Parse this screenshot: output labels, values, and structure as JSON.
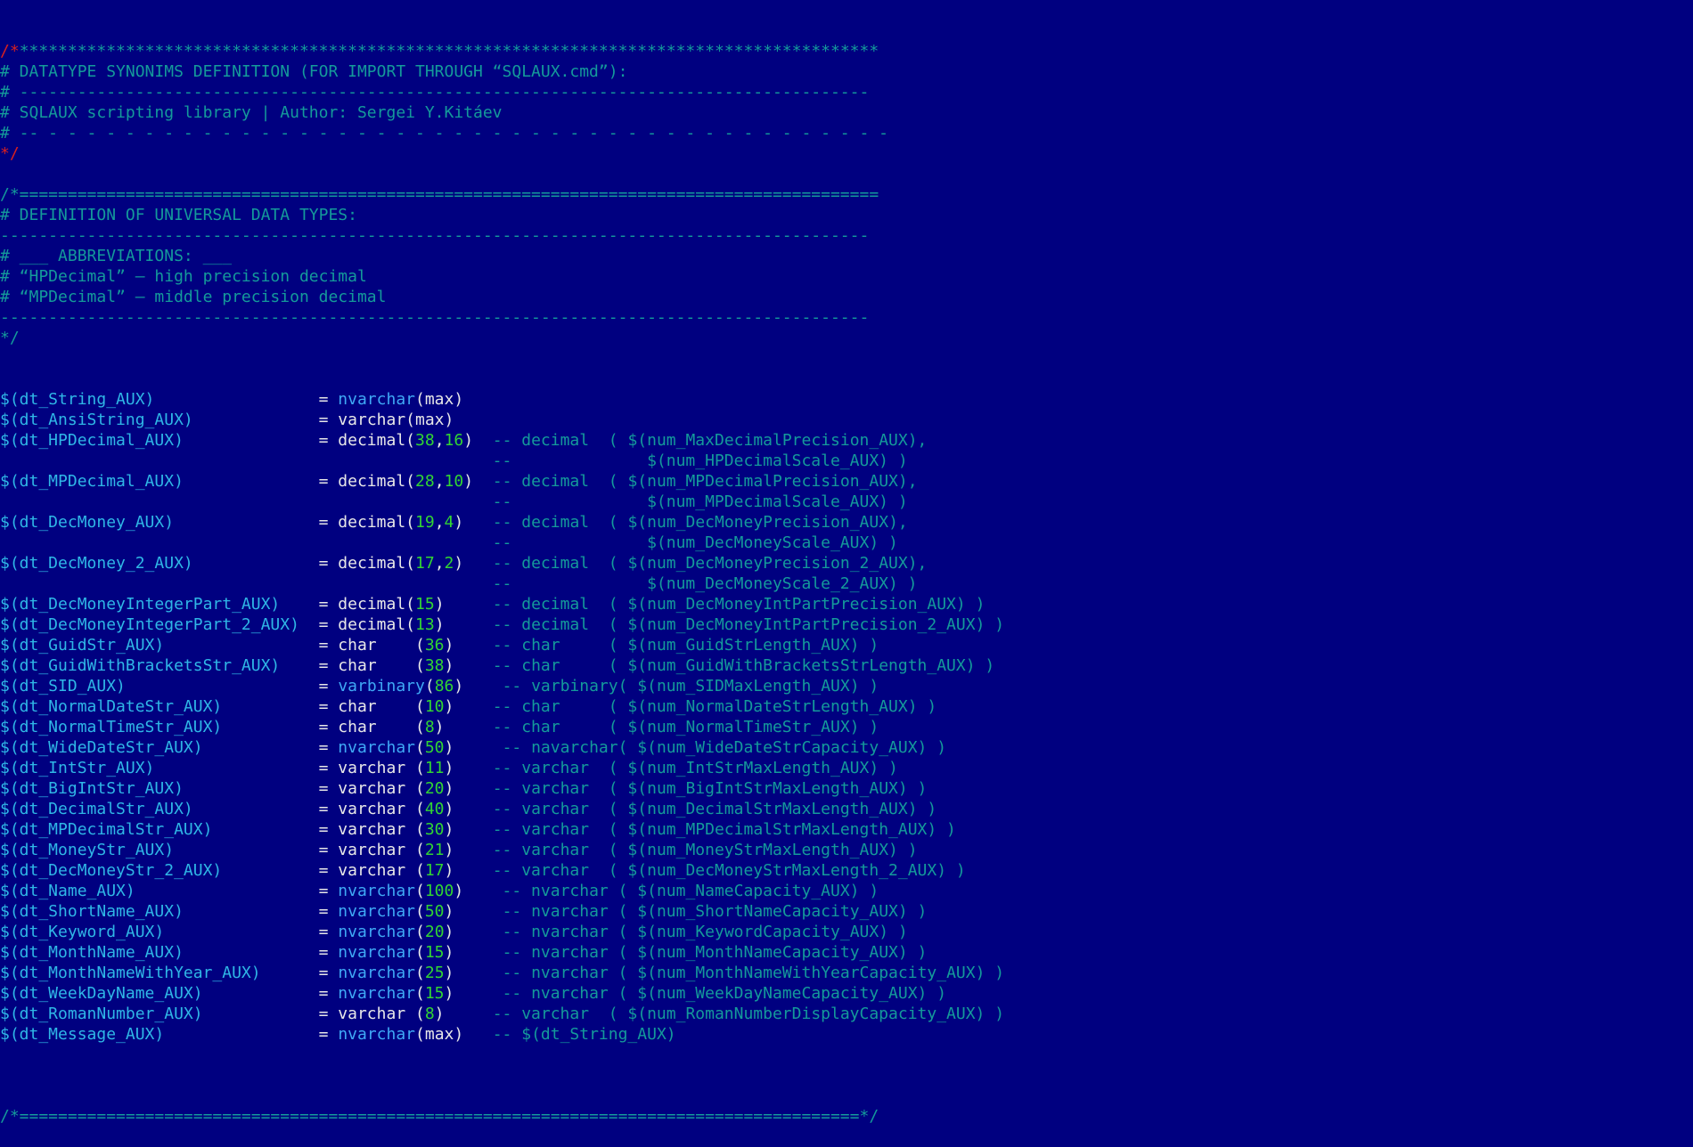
{
  "editor": {
    "background": "#000080",
    "colors": {
      "comment": "#149a9a",
      "comment_delimiter": "#d82020",
      "variable": "#2fb7e6",
      "type_keyword": "#3fa9f5",
      "plain_text": "#e8e8e8",
      "number": "#32d532"
    },
    "header": [
      {
        "segments": [
          {
            "cls": "red",
            "text": "/*"
          },
          {
            "cls": "cm",
            "text": "*****************************************************************************************"
          }
        ]
      },
      {
        "segments": [
          {
            "cls": "cm",
            "text": "# DATATYPE SYNONIMS DEFINITION (FOR IMPORT THROUGH “SQLAUX.cmd”):"
          }
        ]
      },
      {
        "segments": [
          {
            "cls": "cm",
            "text": "# ----------------------------------------------------------------------------------------"
          }
        ]
      },
      {
        "segments": [
          {
            "cls": "cm",
            "text": "# SQLAUX scripting library | Author: Sergei Y.Kitáev"
          }
        ]
      },
      {
        "segments": [
          {
            "cls": "cm",
            "text": "# -- - - - - - - - - - - - - - - - - - - - - - - - - - - - - - - - - - - - - - - - - - - - -"
          }
        ]
      },
      {
        "segments": [
          {
            "cls": "red",
            "text": "*/"
          }
        ]
      },
      {
        "segments": [
          {
            "cls": "cm",
            "text": ""
          }
        ]
      },
      {
        "segments": [
          {
            "cls": "cm",
            "text": "/*========================================================================================="
          }
        ]
      },
      {
        "segments": [
          {
            "cls": "cm",
            "text": "# DEFINITION OF UNIVERSAL DATA TYPES:"
          }
        ]
      },
      {
        "segments": [
          {
            "cls": "cm",
            "text": "------------------------------------------------------------------------------------------"
          }
        ]
      },
      {
        "segments": [
          {
            "cls": "cm",
            "text": "# ___ ABBREVIATIONS: ___"
          }
        ]
      },
      {
        "segments": [
          {
            "cls": "cm",
            "text": "# “HPDecimal” — high precision decimal"
          }
        ]
      },
      {
        "segments": [
          {
            "cls": "cm",
            "text": "# “MPDecimal” — middle precision decimal"
          }
        ]
      },
      {
        "segments": [
          {
            "cls": "cm",
            "text": "------------------------------------------------------------------------------------------"
          }
        ]
      },
      {
        "segments": [
          {
            "cls": "cm",
            "text": "*/"
          }
        ]
      }
    ],
    "definitions": [
      {
        "segments": [
          {
            "cls": "var",
            "text": "$(dt_String_AUX)"
          },
          {
            "cls": "txt",
            "text": "                 = "
          },
          {
            "cls": "kw",
            "text": "nvarchar"
          },
          {
            "cls": "txt",
            "text": "(max)"
          }
        ]
      },
      {
        "segments": [
          {
            "cls": "var",
            "text": "$(dt_AnsiString_AUX)"
          },
          {
            "cls": "txt",
            "text": "             = varchar(max)"
          }
        ]
      },
      {
        "segments": [
          {
            "cls": "var",
            "text": "$(dt_HPDecimal_AUX)"
          },
          {
            "cls": "txt",
            "text": "              = decimal("
          },
          {
            "cls": "num",
            "text": "38"
          },
          {
            "cls": "txt",
            "text": ","
          },
          {
            "cls": "num",
            "text": "16"
          },
          {
            "cls": "txt",
            "text": ")  "
          },
          {
            "cls": "cm",
            "text": "-- decimal  ( $(num_MaxDecimalPrecision_AUX),"
          }
        ]
      },
      {
        "segments": [
          {
            "cls": "cm",
            "text": "                                                   --              $(num_HPDecimalScale_AUX) )"
          }
        ]
      },
      {
        "segments": [
          {
            "cls": "var",
            "text": "$(dt_MPDecimal_AUX)"
          },
          {
            "cls": "txt",
            "text": "              = decimal("
          },
          {
            "cls": "num",
            "text": "28"
          },
          {
            "cls": "txt",
            "text": ","
          },
          {
            "cls": "num",
            "text": "10"
          },
          {
            "cls": "txt",
            "text": ")  "
          },
          {
            "cls": "cm",
            "text": "-- decimal  ( $(num_MPDecimalPrecision_AUX),"
          }
        ]
      },
      {
        "segments": [
          {
            "cls": "cm",
            "text": "                                                   --              $(num_MPDecimalScale_AUX) )"
          }
        ]
      },
      {
        "segments": [
          {
            "cls": "var",
            "text": "$(dt_DecMoney_AUX)"
          },
          {
            "cls": "txt",
            "text": "               = decimal("
          },
          {
            "cls": "num",
            "text": "19"
          },
          {
            "cls": "txt",
            "text": ","
          },
          {
            "cls": "num",
            "text": "4"
          },
          {
            "cls": "txt",
            "text": ")   "
          },
          {
            "cls": "cm",
            "text": "-- decimal  ( $(num_DecMoneyPrecision_AUX),"
          }
        ]
      },
      {
        "segments": [
          {
            "cls": "cm",
            "text": "                                                   --              $(num_DecMoneyScale_AUX) )"
          }
        ]
      },
      {
        "segments": [
          {
            "cls": "var",
            "text": "$(dt_DecMoney_2_AUX)"
          },
          {
            "cls": "txt",
            "text": "             = decimal("
          },
          {
            "cls": "num",
            "text": "17"
          },
          {
            "cls": "txt",
            "text": ","
          },
          {
            "cls": "num",
            "text": "2"
          },
          {
            "cls": "txt",
            "text": ")   "
          },
          {
            "cls": "cm",
            "text": "-- decimal  ( $(num_DecMoneyPrecision_2_AUX),"
          }
        ]
      },
      {
        "segments": [
          {
            "cls": "cm",
            "text": "                                                   --              $(num_DecMoneyScale_2_AUX) )"
          }
        ]
      },
      {
        "segments": [
          {
            "cls": "var",
            "text": "$(dt_DecMoneyIntegerPart_AUX)"
          },
          {
            "cls": "txt",
            "text": "    = decimal("
          },
          {
            "cls": "num",
            "text": "15"
          },
          {
            "cls": "txt",
            "text": ")     "
          },
          {
            "cls": "cm",
            "text": "-- decimal  ( $(num_DecMoneyIntPartPrecision_AUX) )"
          }
        ]
      },
      {
        "segments": [
          {
            "cls": "var",
            "text": "$(dt_DecMoneyIntegerPart_2_AUX)"
          },
          {
            "cls": "txt",
            "text": "  = decimal("
          },
          {
            "cls": "num",
            "text": "13"
          },
          {
            "cls": "txt",
            "text": ")     "
          },
          {
            "cls": "cm",
            "text": "-- decimal  ( $(num_DecMoneyIntPartPrecision_2_AUX) )"
          }
        ]
      },
      {
        "segments": [
          {
            "cls": "var",
            "text": "$(dt_GuidStr_AUX)"
          },
          {
            "cls": "txt",
            "text": "                = char    ("
          },
          {
            "cls": "num",
            "text": "36"
          },
          {
            "cls": "txt",
            "text": ")    "
          },
          {
            "cls": "cm",
            "text": "-- char     ( $(num_GuidStrLength_AUX) )"
          }
        ]
      },
      {
        "segments": [
          {
            "cls": "var",
            "text": "$(dt_GuidWithBracketsStr_AUX)"
          },
          {
            "cls": "txt",
            "text": "    = char    ("
          },
          {
            "cls": "num",
            "text": "38"
          },
          {
            "cls": "txt",
            "text": ")    "
          },
          {
            "cls": "cm",
            "text": "-- char     ( $(num_GuidWithBracketsStrLength_AUX) )"
          }
        ]
      },
      {
        "segments": [
          {
            "cls": "var",
            "text": "$(dt_SID_AUX)"
          },
          {
            "cls": "txt",
            "text": "                    = "
          },
          {
            "cls": "kw",
            "text": "varbinary"
          },
          {
            "cls": "txt",
            "text": "("
          },
          {
            "cls": "num",
            "text": "86"
          },
          {
            "cls": "txt",
            "text": ")    "
          },
          {
            "cls": "cm",
            "text": "-- varbinary( $(num_SIDMaxLength_AUX) )"
          }
        ]
      },
      {
        "segments": [
          {
            "cls": "var",
            "text": "$(dt_NormalDateStr_AUX)"
          },
          {
            "cls": "txt",
            "text": "          = char    ("
          },
          {
            "cls": "num",
            "text": "10"
          },
          {
            "cls": "txt",
            "text": ")    "
          },
          {
            "cls": "cm",
            "text": "-- char     ( $(num_NormalDateStrLength_AUX) )"
          }
        ]
      },
      {
        "segments": [
          {
            "cls": "var",
            "text": "$(dt_NormalTimeStr_AUX)"
          },
          {
            "cls": "txt",
            "text": "          = char    ("
          },
          {
            "cls": "num",
            "text": "8"
          },
          {
            "cls": "txt",
            "text": ")     "
          },
          {
            "cls": "cm",
            "text": "-- char     ( $(num_NormalTimeStr_AUX) )"
          }
        ]
      },
      {
        "segments": [
          {
            "cls": "var",
            "text": "$(dt_WideDateStr_AUX)"
          },
          {
            "cls": "txt",
            "text": "            = "
          },
          {
            "cls": "kw",
            "text": "nvarchar"
          },
          {
            "cls": "txt",
            "text": "("
          },
          {
            "cls": "num",
            "text": "50"
          },
          {
            "cls": "txt",
            "text": ")     "
          },
          {
            "cls": "cm",
            "text": "-- navarchar( $(num_WideDateStrCapacity_AUX) )"
          }
        ]
      },
      {
        "segments": [
          {
            "cls": "var",
            "text": "$(dt_IntStr_AUX)"
          },
          {
            "cls": "txt",
            "text": "                 = varchar ("
          },
          {
            "cls": "num",
            "text": "11"
          },
          {
            "cls": "txt",
            "text": ")    "
          },
          {
            "cls": "cm",
            "text": "-- varchar  ( $(num_IntStrMaxLength_AUX) )"
          }
        ]
      },
      {
        "segments": [
          {
            "cls": "var",
            "text": "$(dt_BigIntStr_AUX)"
          },
          {
            "cls": "txt",
            "text": "              = varchar ("
          },
          {
            "cls": "num",
            "text": "20"
          },
          {
            "cls": "txt",
            "text": ")    "
          },
          {
            "cls": "cm",
            "text": "-- varchar  ( $(num_BigIntStrMaxLength_AUX) )"
          }
        ]
      },
      {
        "segments": [
          {
            "cls": "var",
            "text": "$(dt_DecimalStr_AUX)"
          },
          {
            "cls": "txt",
            "text": "             = varchar ("
          },
          {
            "cls": "num",
            "text": "40"
          },
          {
            "cls": "txt",
            "text": ")    "
          },
          {
            "cls": "cm",
            "text": "-- varchar  ( $(num_DecimalStrMaxLength_AUX) )"
          }
        ]
      },
      {
        "segments": [
          {
            "cls": "var",
            "text": "$(dt_MPDecimalStr_AUX)"
          },
          {
            "cls": "txt",
            "text": "           = varchar ("
          },
          {
            "cls": "num",
            "text": "30"
          },
          {
            "cls": "txt",
            "text": ")    "
          },
          {
            "cls": "cm",
            "text": "-- varchar  ( $(num_MPDecimalStrMaxLength_AUX) )"
          }
        ]
      },
      {
        "segments": [
          {
            "cls": "var",
            "text": "$(dt_MoneyStr_AUX)"
          },
          {
            "cls": "txt",
            "text": "               = varchar ("
          },
          {
            "cls": "num",
            "text": "21"
          },
          {
            "cls": "txt",
            "text": ")    "
          },
          {
            "cls": "cm",
            "text": "-- varchar  ( $(num_MoneyStrMaxLength_AUX) )"
          }
        ]
      },
      {
        "segments": [
          {
            "cls": "var",
            "text": "$(dt_DecMoneyStr_2_AUX)"
          },
          {
            "cls": "txt",
            "text": "          = varchar ("
          },
          {
            "cls": "num",
            "text": "17"
          },
          {
            "cls": "txt",
            "text": ")    "
          },
          {
            "cls": "cm",
            "text": "-- varchar  ( $(num_DecMoneyStrMaxLength_2_AUX) )"
          }
        ]
      },
      {
        "segments": [
          {
            "cls": "var",
            "text": "$(dt_Name_AUX)"
          },
          {
            "cls": "txt",
            "text": "                   = "
          },
          {
            "cls": "kw",
            "text": "nvarchar"
          },
          {
            "cls": "txt",
            "text": "("
          },
          {
            "cls": "num",
            "text": "100"
          },
          {
            "cls": "txt",
            "text": ")    "
          },
          {
            "cls": "cm",
            "text": "-- nvarchar ( $(num_NameCapacity_AUX) )"
          }
        ]
      },
      {
        "segments": [
          {
            "cls": "var",
            "text": "$(dt_ShortName_AUX)"
          },
          {
            "cls": "txt",
            "text": "              = "
          },
          {
            "cls": "kw",
            "text": "nvarchar"
          },
          {
            "cls": "txt",
            "text": "("
          },
          {
            "cls": "num",
            "text": "50"
          },
          {
            "cls": "txt",
            "text": ")     "
          },
          {
            "cls": "cm",
            "text": "-- nvarchar ( $(num_ShortNameCapacity_AUX) )"
          }
        ]
      },
      {
        "segments": [
          {
            "cls": "var",
            "text": "$(dt_Keyword_AUX)"
          },
          {
            "cls": "txt",
            "text": "                = "
          },
          {
            "cls": "kw",
            "text": "nvarchar"
          },
          {
            "cls": "txt",
            "text": "("
          },
          {
            "cls": "num",
            "text": "20"
          },
          {
            "cls": "txt",
            "text": ")     "
          },
          {
            "cls": "cm",
            "text": "-- nvarchar ( $(num_KeywordCapacity_AUX) )"
          }
        ]
      },
      {
        "segments": [
          {
            "cls": "var",
            "text": "$(dt_MonthName_AUX)"
          },
          {
            "cls": "txt",
            "text": "              = "
          },
          {
            "cls": "kw",
            "text": "nvarchar"
          },
          {
            "cls": "txt",
            "text": "("
          },
          {
            "cls": "num",
            "text": "15"
          },
          {
            "cls": "txt",
            "text": ")     "
          },
          {
            "cls": "cm",
            "text": "-- nvarchar ( $(num_MonthNameCapacity_AUX) )"
          }
        ]
      },
      {
        "segments": [
          {
            "cls": "var",
            "text": "$(dt_MonthNameWithYear_AUX)"
          },
          {
            "cls": "txt",
            "text": "      = "
          },
          {
            "cls": "kw",
            "text": "nvarchar"
          },
          {
            "cls": "txt",
            "text": "("
          },
          {
            "cls": "num",
            "text": "25"
          },
          {
            "cls": "txt",
            "text": ")     "
          },
          {
            "cls": "cm",
            "text": "-- nvarchar ( $(num_MonthNameWithYearCapacity_AUX) )"
          }
        ]
      },
      {
        "segments": [
          {
            "cls": "var",
            "text": "$(dt_WeekDayName_AUX)"
          },
          {
            "cls": "txt",
            "text": "            = "
          },
          {
            "cls": "kw",
            "text": "nvarchar"
          },
          {
            "cls": "txt",
            "text": "("
          },
          {
            "cls": "num",
            "text": "15"
          },
          {
            "cls": "txt",
            "text": ")     "
          },
          {
            "cls": "cm",
            "text": "-- nvarchar ( $(num_WeekDayNameCapacity_AUX) )"
          }
        ]
      },
      {
        "segments": [
          {
            "cls": "var",
            "text": "$(dt_RomanNumber_AUX)"
          },
          {
            "cls": "txt",
            "text": "            = varchar ("
          },
          {
            "cls": "num",
            "text": "8"
          },
          {
            "cls": "txt",
            "text": ")     "
          },
          {
            "cls": "cm",
            "text": "-- varchar  ( $(num_RomanNumberDisplayCapacity_AUX) )"
          }
        ]
      },
      {
        "segments": [
          {
            "cls": "var",
            "text": "$(dt_Message_AUX)"
          },
          {
            "cls": "txt",
            "text": "                = "
          },
          {
            "cls": "kw",
            "text": "nvarchar"
          },
          {
            "cls": "txt",
            "text": "(max)   "
          },
          {
            "cls": "cm",
            "text": "-- $(dt_String_AUX)"
          }
        ]
      }
    ],
    "footer": [
      {
        "segments": [
          {
            "cls": "cm",
            "text": ""
          }
        ]
      },
      {
        "segments": [
          {
            "cls": "cm",
            "text": "/*=======================================================================================*/"
          }
        ]
      }
    ]
  }
}
